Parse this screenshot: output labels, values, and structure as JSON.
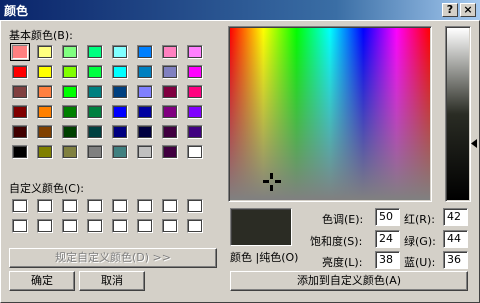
{
  "window": {
    "title": "颜色",
    "help_label": "?",
    "close_label": "×"
  },
  "basic": {
    "label": "基本颜色(B):",
    "swatches": [
      "#ff8080",
      "#ffff80",
      "#80ff80",
      "#00ff80",
      "#80ffff",
      "#0080ff",
      "#ff80c0",
      "#ff80ff",
      "#ff0000",
      "#ffff00",
      "#80ff00",
      "#00ff40",
      "#00ffff",
      "#0080c0",
      "#8080c0",
      "#ff00ff",
      "#804040",
      "#ff8040",
      "#00ff00",
      "#008080",
      "#004080",
      "#8080ff",
      "#800040",
      "#ff0080",
      "#800000",
      "#ff8000",
      "#008000",
      "#008040",
      "#0000ff",
      "#0000a0",
      "#800080",
      "#8000ff",
      "#400000",
      "#804000",
      "#004000",
      "#004040",
      "#000080",
      "#000040",
      "#400040",
      "#400080",
      "#000000",
      "#808000",
      "#808040",
      "#808080",
      "#408080",
      "#c0c0c0",
      "#400040",
      "#ffffff"
    ]
  },
  "custom": {
    "label": "自定义颜色(C):",
    "count": 16
  },
  "buttons": {
    "define_custom": "规定自定义颜色(D) >>",
    "ok": "确定",
    "cancel": "取消",
    "add_custom": "添加到自定义颜色(A)"
  },
  "preview": {
    "color_label": "颜色 |纯色(O)",
    "color": "#2b2c24"
  },
  "fields": {
    "hue": {
      "label": "色调(E):",
      "value": "50"
    },
    "sat": {
      "label": "饱和度(S):",
      "value": "24"
    },
    "lum": {
      "label": "亮度(L):",
      "value": "38"
    },
    "red": {
      "label": "红(R):",
      "value": "42"
    },
    "green": {
      "label": "绿(G):",
      "value": "44"
    },
    "blue": {
      "label": "蓝(U):",
      "value": "36"
    }
  }
}
